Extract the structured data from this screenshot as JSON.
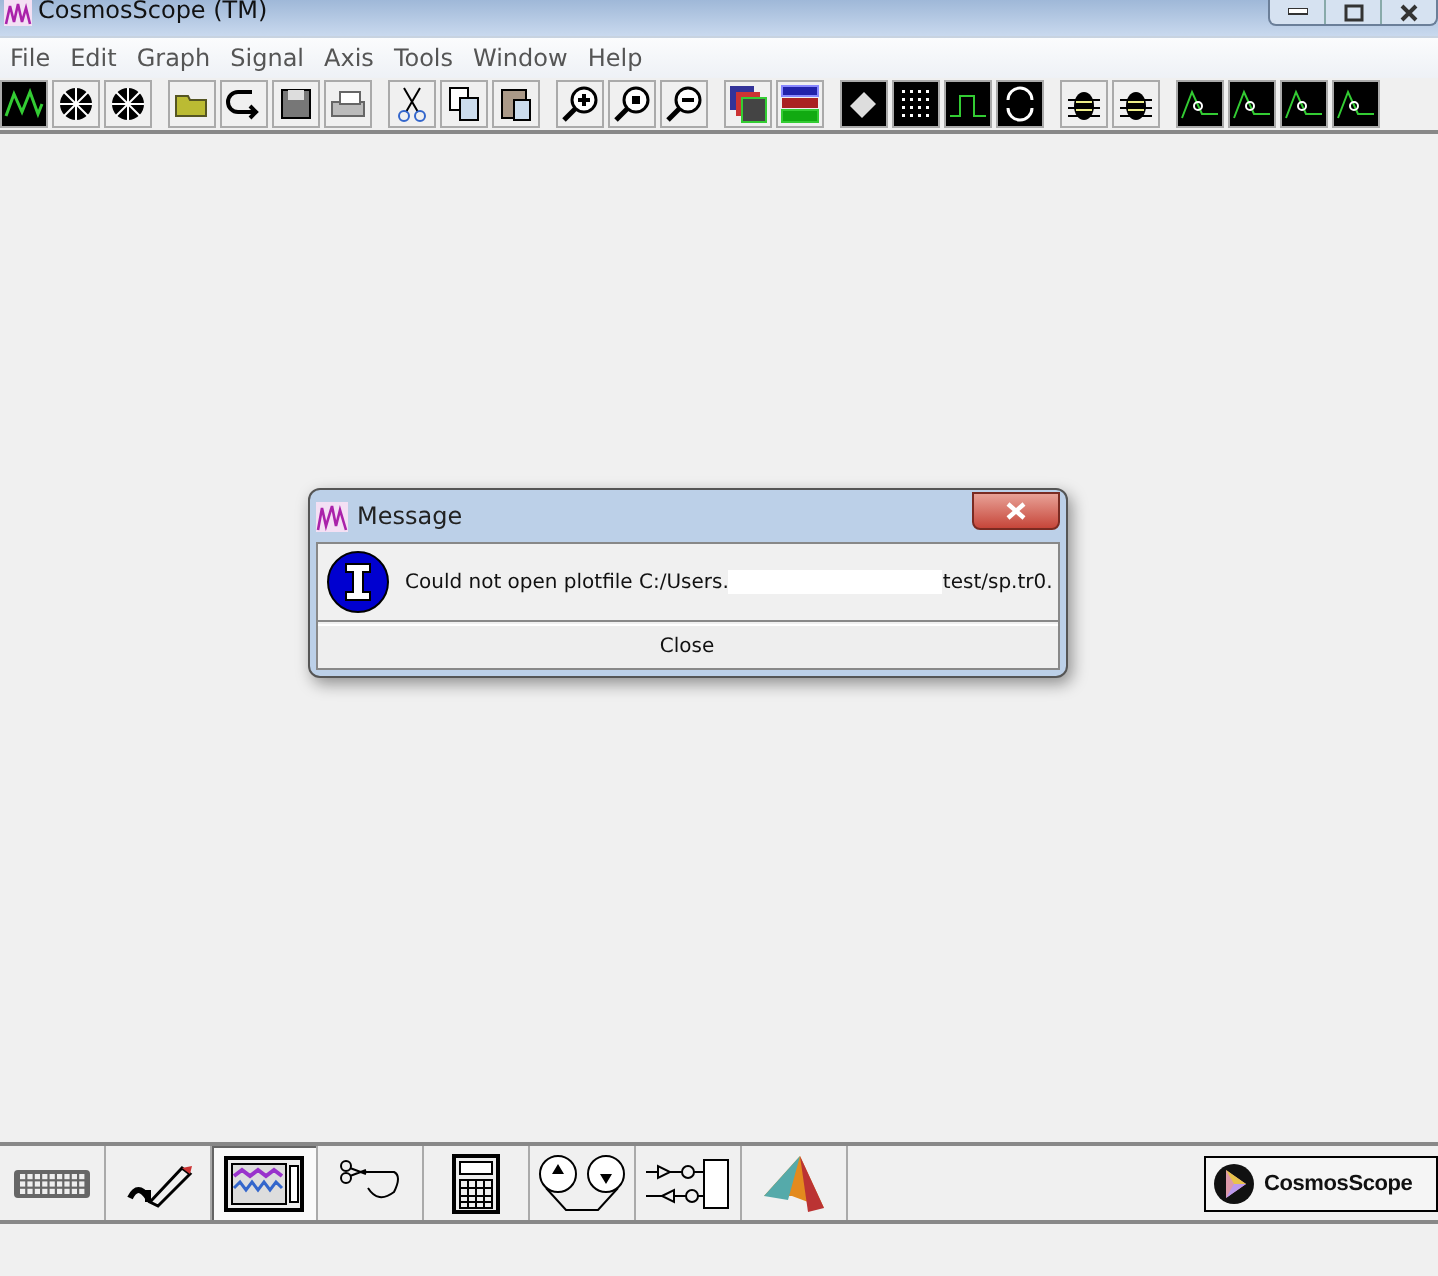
{
  "window": {
    "title": "CosmosScope (TM)"
  },
  "menu": [
    "File",
    "Edit",
    "Graph",
    "Signal",
    "Axis",
    "Tools",
    "Window",
    "Help"
  ],
  "dialog": {
    "title": "Message",
    "message": "Could not open plotfile C:/Users.",
    "message_tail": "test/sp.tr0.",
    "button": "Close"
  },
  "bottom_tools": [
    {
      "kind": "keyboard",
      "selected": false
    },
    {
      "kind": "pencil",
      "selected": false
    },
    {
      "kind": "scope",
      "selected": true
    },
    {
      "kind": "scissors",
      "selected": false
    },
    {
      "kind": "calculator",
      "selected": false
    },
    {
      "kind": "reels",
      "selected": false
    },
    {
      "kind": "blocks",
      "selected": false
    },
    {
      "kind": "peak",
      "selected": false
    }
  ],
  "logo": {
    "text": "CosmosScope"
  }
}
